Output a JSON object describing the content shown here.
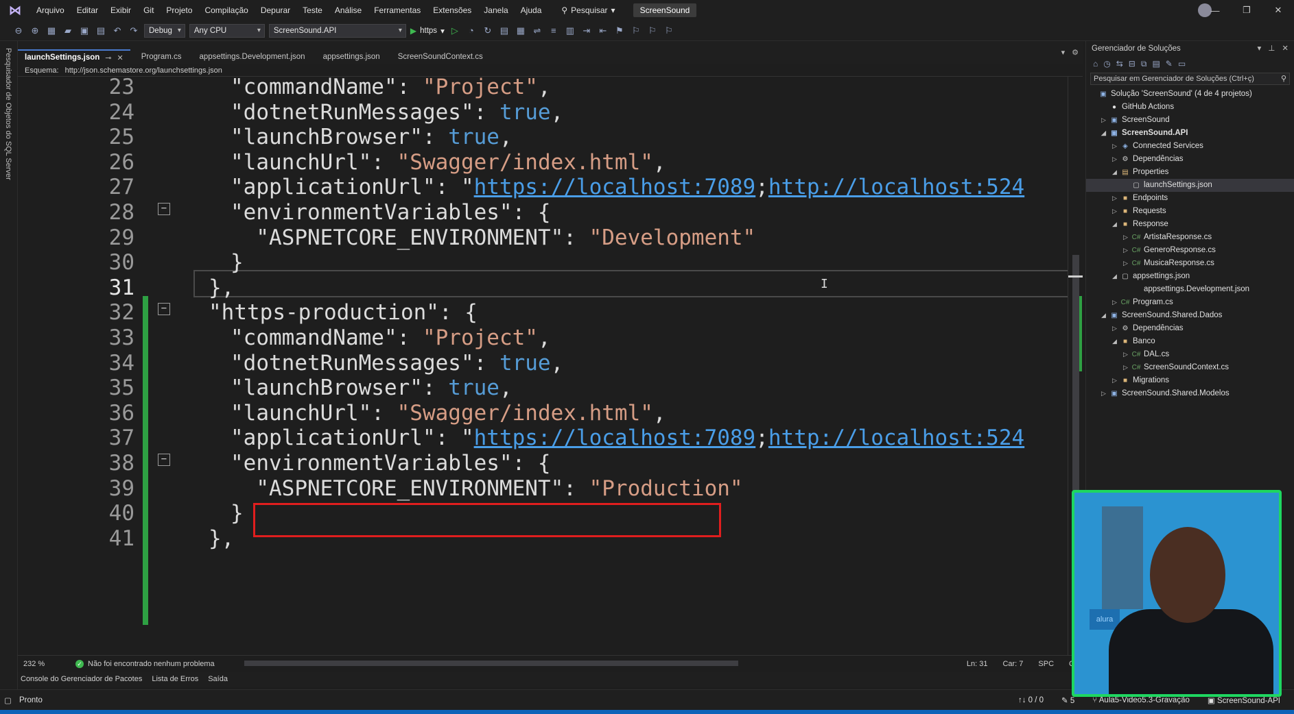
{
  "menu": {
    "items": [
      "Arquivo",
      "Editar",
      "Exibir",
      "Git",
      "Projeto",
      "Compilação",
      "Depurar",
      "Teste",
      "Análise",
      "Ferramentas",
      "Extensões",
      "Janela",
      "Ajuda"
    ],
    "search_label": "Pesquisar",
    "solution_name": "ScreenSound"
  },
  "toolbar": {
    "config": "Debug",
    "platform": "Any CPU",
    "startup_project": "ScreenSound.API",
    "run_profile": "https"
  },
  "left_strip": {
    "label": "Pesquisador de Objetos do SQL Server"
  },
  "tabs": [
    {
      "label": "launchSettings.json",
      "active": true
    },
    {
      "label": "Program.cs",
      "active": false
    },
    {
      "label": "appsettings.Development.json",
      "active": false
    },
    {
      "label": "appsettings.json",
      "active": false
    },
    {
      "label": "ScreenSoundContext.cs",
      "active": false
    }
  ],
  "schema": {
    "label": "Esquema:",
    "url": "http://json.schemastore.org/launchsettings.json"
  },
  "editor": {
    "lines": [
      {
        "n": "23",
        "parts": [
          [
            "k",
            "\"commandName\": "
          ],
          [
            "s",
            "\"Project\""
          ],
          [
            "k",
            ","
          ]
        ]
      },
      {
        "n": "24",
        "parts": [
          [
            "k",
            "\"dotnetRunMessages\": "
          ],
          [
            "b",
            "true"
          ],
          [
            "k",
            ","
          ]
        ]
      },
      {
        "n": "25",
        "parts": [
          [
            "k",
            "\"launchBrowser\": "
          ],
          [
            "b",
            "true"
          ],
          [
            "k",
            ","
          ]
        ]
      },
      {
        "n": "26",
        "parts": [
          [
            "k",
            "\"launchUrl\": "
          ],
          [
            "s",
            "\"Swagger/index.html\""
          ],
          [
            "k",
            ","
          ]
        ]
      },
      {
        "n": "27",
        "parts": [
          [
            "k",
            "\"applicationUrl\": \""
          ],
          [
            "u",
            "https://localhost:7089"
          ],
          [
            "k",
            ";"
          ],
          [
            "u",
            "http://localhost:524"
          ]
        ]
      },
      {
        "n": "28",
        "parts": [
          [
            "k",
            "\"environmentVariables\": {"
          ]
        ]
      },
      {
        "n": "29",
        "parts": [
          [
            "k",
            "  \"ASPNETCORE_ENVIRONMENT\": "
          ],
          [
            "s",
            "\"Development\""
          ]
        ]
      },
      {
        "n": "30",
        "parts": [
          [
            "k",
            "}"
          ]
        ]
      },
      {
        "n": "31",
        "parts": [
          [
            "k",
            "},"
          ]
        ]
      },
      {
        "n": "32",
        "parts": [
          [
            "k",
            "\"https-production\": {"
          ]
        ]
      },
      {
        "n": "33",
        "parts": [
          [
            "k",
            "\"commandName\": "
          ],
          [
            "s",
            "\"Project\""
          ],
          [
            "k",
            ","
          ]
        ]
      },
      {
        "n": "34",
        "parts": [
          [
            "k",
            "\"dotnetRunMessages\": "
          ],
          [
            "b",
            "true"
          ],
          [
            "k",
            ","
          ]
        ]
      },
      {
        "n": "35",
        "parts": [
          [
            "k",
            "\"launchBrowser\": "
          ],
          [
            "b",
            "true"
          ],
          [
            "k",
            ","
          ]
        ]
      },
      {
        "n": "36",
        "parts": [
          [
            "k",
            "\"launchUrl\": "
          ],
          [
            "s",
            "\"Swagger/index.html\""
          ],
          [
            "k",
            ","
          ]
        ]
      },
      {
        "n": "37",
        "parts": [
          [
            "k",
            "\"applicationUrl\": \""
          ],
          [
            "u",
            "https://localhost:7089"
          ],
          [
            "k",
            ";"
          ],
          [
            "u",
            "http://localhost:524"
          ]
        ]
      },
      {
        "n": "38",
        "parts": [
          [
            "k",
            "\"environmentVariables\": {"
          ]
        ]
      },
      {
        "n": "39",
        "parts": [
          [
            "k",
            "  \"ASPNETCORE_ENVIRONMENT\": "
          ],
          [
            "s",
            "\"Production\""
          ]
        ]
      },
      {
        "n": "40",
        "parts": [
          [
            "k",
            "}"
          ]
        ]
      },
      {
        "n": "41",
        "parts": [
          [
            "k",
            "},"
          ]
        ]
      }
    ],
    "current_line": "31"
  },
  "editor_status": {
    "zoom": "232 %",
    "issues": "Não foi encontrado nenhum problema",
    "line": "Ln: 31",
    "col": "Car: 7",
    "mode": "SPC",
    "eol": "C"
  },
  "output_tabs": [
    "Console do Gerenciador de Pacotes",
    "Lista de Erros",
    "Saída"
  ],
  "statusbar": {
    "ready": "Pronto",
    "sync": "↑↓ 0 / 0",
    "changes": "5",
    "branch": "Aula5-Video5.3-Gravação",
    "repo": "ScreenSound-API"
  },
  "solution_explorer": {
    "title": "Gerenciador de Soluções",
    "search_placeholder": "Pesquisar em Gerenciador de Soluções (Ctrl+ç)",
    "nodes": [
      {
        "label": "Solução 'ScreenSound' (4 de 4 projetos)",
        "indent": 0,
        "arrow": "",
        "icon": "▣",
        "cls": "proj"
      },
      {
        "label": "GitHub Actions",
        "indent": 1,
        "arrow": "",
        "icon": "●",
        "cls": "gh"
      },
      {
        "label": "ScreenSound",
        "indent": 1,
        "arrow": "▷",
        "icon": "▣",
        "cls": "proj"
      },
      {
        "label": "ScreenSound.API",
        "indent": 1,
        "arrow": "◢",
        "icon": "▣",
        "cls": "proj",
        "bold": true
      },
      {
        "label": "Connected Services",
        "indent": 2,
        "arrow": "▷",
        "icon": "◈",
        "cls": "proj"
      },
      {
        "label": "Dependências",
        "indent": 2,
        "arrow": "▷",
        "icon": "⚙",
        "cls": "json"
      },
      {
        "label": "Properties",
        "indent": 2,
        "arrow": "◢",
        "icon": "▤",
        "cls": "folder"
      },
      {
        "label": "launchSettings.json",
        "indent": 3,
        "arrow": "",
        "icon": "▢",
        "cls": "json",
        "selected": true
      },
      {
        "label": "Endpoints",
        "indent": 2,
        "arrow": "▷",
        "icon": "■",
        "cls": "folder"
      },
      {
        "label": "Requests",
        "indent": 2,
        "arrow": "▷",
        "icon": "■",
        "cls": "folder"
      },
      {
        "label": "Response",
        "indent": 2,
        "arrow": "◢",
        "icon": "■",
        "cls": "folder"
      },
      {
        "label": "ArtistaResponse.cs",
        "indent": 3,
        "arrow": "▷",
        "icon": "C#",
        "cls": "cs"
      },
      {
        "label": "GeneroResponse.cs",
        "indent": 3,
        "arrow": "▷",
        "icon": "C#",
        "cls": "cs"
      },
      {
        "label": "MusicaResponse.cs",
        "indent": 3,
        "arrow": "▷",
        "icon": "C#",
        "cls": "cs"
      },
      {
        "label": "appsettings.json",
        "indent": 2,
        "arrow": "◢",
        "icon": "▢",
        "cls": "json"
      },
      {
        "label": "appsettings.Development.json",
        "indent": 3,
        "arrow": "",
        "icon": "",
        "cls": "json"
      },
      {
        "label": "Program.cs",
        "indent": 2,
        "arrow": "▷",
        "icon": "C#",
        "cls": "cs"
      },
      {
        "label": "ScreenSound.Shared.Dados",
        "indent": 1,
        "arrow": "◢",
        "icon": "▣",
        "cls": "proj"
      },
      {
        "label": "Dependências",
        "indent": 2,
        "arrow": "▷",
        "icon": "⚙",
        "cls": "json"
      },
      {
        "label": "Banco",
        "indent": 2,
        "arrow": "◢",
        "icon": "■",
        "cls": "folder"
      },
      {
        "label": "DAL.cs",
        "indent": 3,
        "arrow": "▷",
        "icon": "C#",
        "cls": "cs"
      },
      {
        "label": "ScreenSoundContext.cs",
        "indent": 3,
        "arrow": "▷",
        "icon": "C#",
        "cls": "cs"
      },
      {
        "label": "Migrations",
        "indent": 2,
        "arrow": "▷",
        "icon": "■",
        "cls": "folder"
      },
      {
        "label": "ScreenSound.Shared.Modelos",
        "indent": 1,
        "arrow": "▷",
        "icon": "▣",
        "cls": "proj"
      }
    ]
  },
  "webcam": {
    "logo_text": "alura"
  }
}
